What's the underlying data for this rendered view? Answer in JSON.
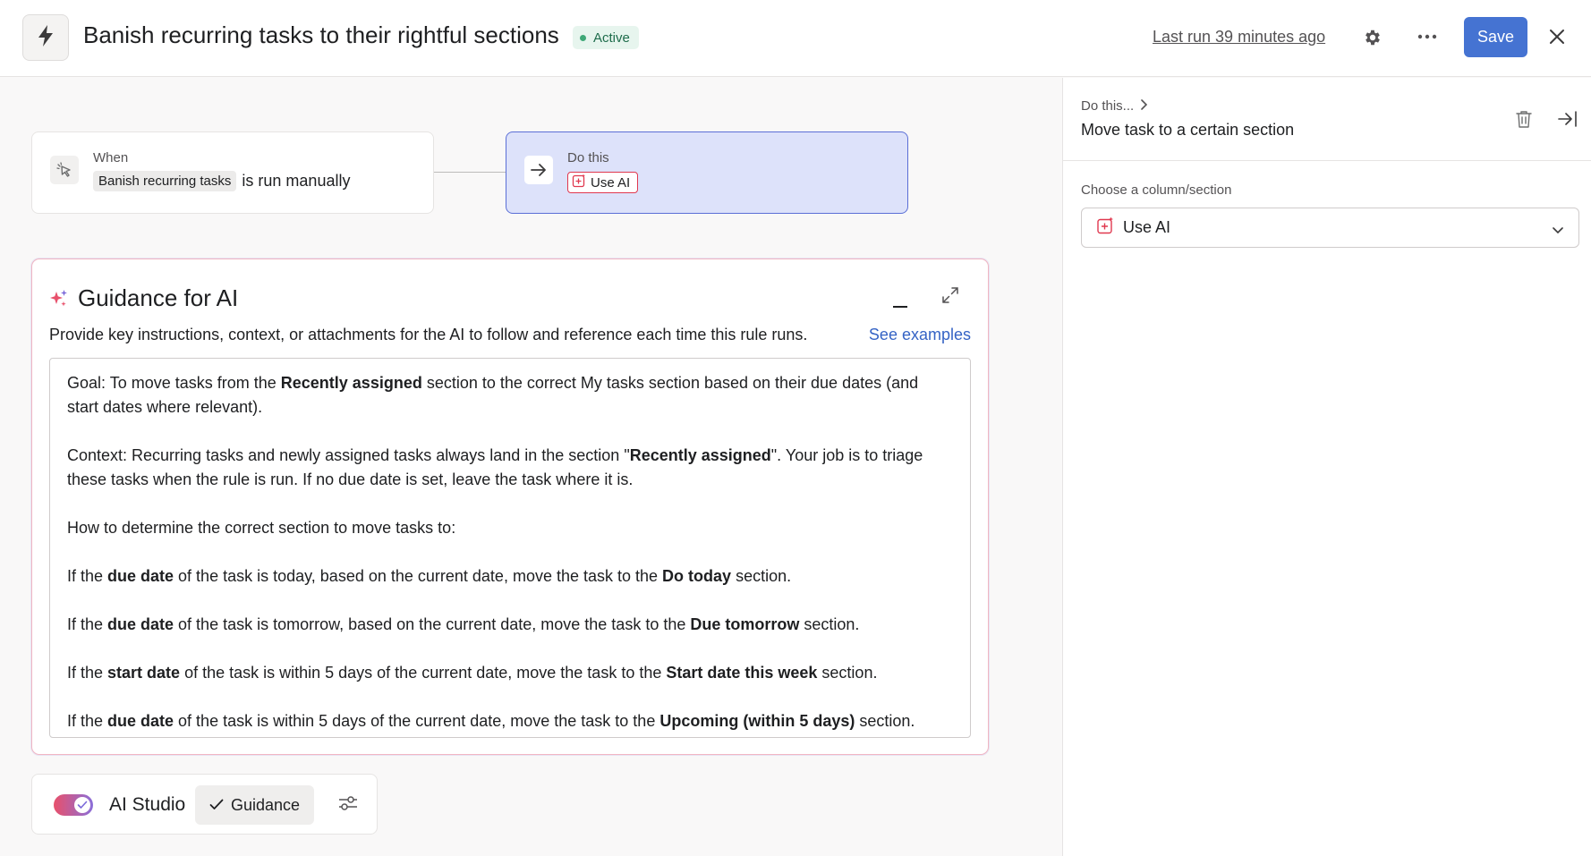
{
  "header": {
    "title": "Banish recurring tasks to their rightful sections",
    "status": "Active",
    "last_run": "Last run 39 minutes ago",
    "save_label": "Save"
  },
  "trigger": {
    "eyebrow": "When",
    "rule_chip": "Banish recurring tasks",
    "suffix": "is run manually"
  },
  "action": {
    "eyebrow": "Do this",
    "chip": "Use AI"
  },
  "guidance": {
    "title": "Guidance for AI",
    "description": "Provide key instructions, context, or attachments for the AI to follow and reference each time this rule runs.",
    "see_examples": "See examples",
    "p1": {
      "a": "Goal: To move tasks from the ",
      "b": "Recently assigned",
      "c": " section to the correct My tasks section based on their due dates (and start dates where relevant)."
    },
    "p2": {
      "a": "Context: Recurring tasks and newly assigned tasks always land in the section \"",
      "b": "Recently assigned",
      "c": "\". Your job is to triage these tasks when the rule is run. If no due date is set, leave the task where it is."
    },
    "p3": "How to determine the correct section to move tasks to:",
    "p4": {
      "a": "If the ",
      "b": "due date",
      "c": " of the task is today, based on the current date, move the task to the ",
      "d": "Do today",
      "e": " section."
    },
    "p5": {
      "a": "If the ",
      "b": "due date",
      "c": " of the task is tomorrow, based on the current date, move the task to the ",
      "d": "Due tomorrow",
      "e": " section."
    },
    "p6": {
      "a": "If the ",
      "b": "start date",
      "c": " of the task is within 5 days of the current date, move the task to the ",
      "d": "Start date this week",
      "e": " section."
    },
    "p7": {
      "a": "If the ",
      "b": "due date",
      "c": " of the task is within 5 days of the current date, move the task to the ",
      "d": "Upcoming (within 5 days)",
      "e": " section."
    }
  },
  "bottom_bar": {
    "ai_studio_label": "AI Studio",
    "ai_studio_enabled": true,
    "guidance_chip": "Guidance"
  },
  "panel": {
    "breadcrumb": "Do this...",
    "title": "Move task to a certain section",
    "field_label": "Choose a column/section",
    "field_value": "Use AI"
  },
  "colors": {
    "accent": "#4573d2",
    "ai_red": "#e0384f",
    "action_card_bg": "#dde2fa",
    "status_green": "#3fa877"
  }
}
